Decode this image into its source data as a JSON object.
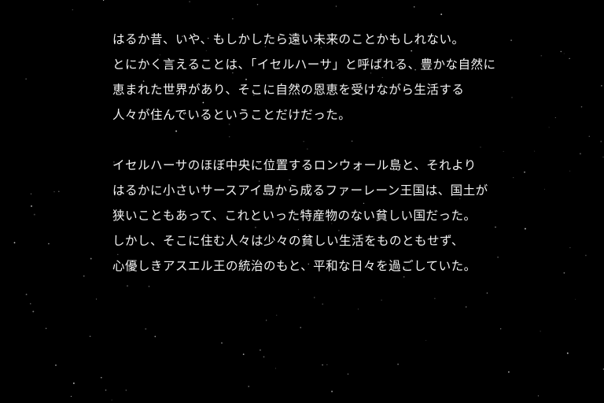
{
  "story": {
    "paragraphs": [
      [
        "はるか昔、いや、もしかしたら遠い未来のことかもしれない。",
        "とにかく言えることは、「イセルハーサ」と呼ばれる、豊かな自然に",
        "恵まれた世界があり、そこに自然の恩恵を受けながら生活する",
        "人々が住んでいるということだけだった。"
      ],
      [
        "イセルハーサのほぼ中央に位置するロンウォール島と、それより",
        "はるかに小さいサースアイ島から成るファーレーン王国は、国土が",
        "狭いこともあって、これといった特産物のない貧しい国だった。",
        "しかし、そこに住む人々は少々の貧しい生活をものともせず、",
        "心優しきアスエル王の統治のもと、平和な日々を過ごしていた。"
      ]
    ]
  },
  "colors": {
    "background": "#000000",
    "text": "#f2f2f2",
    "star": "#ffffff"
  }
}
